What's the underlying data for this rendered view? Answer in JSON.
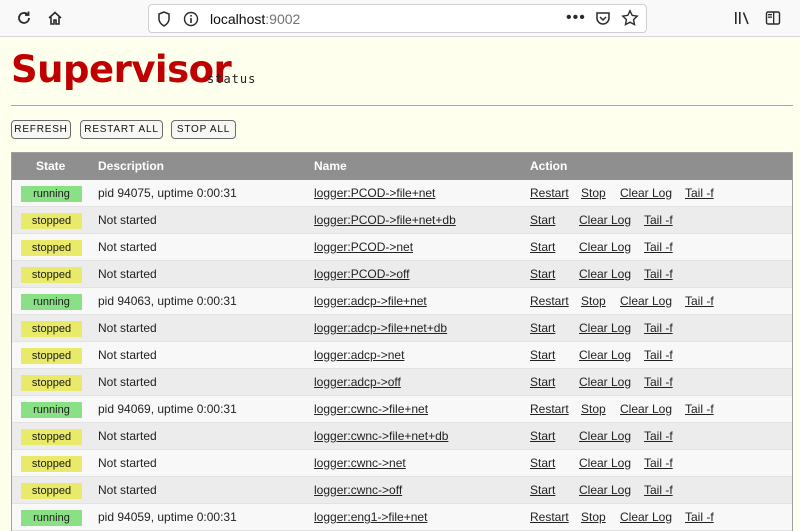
{
  "browser": {
    "url_host": "localhost",
    "url_port": ":9002"
  },
  "header": {
    "title": "Supervisor",
    "subtitle": "status"
  },
  "controls": {
    "refresh": "REFRESH",
    "restart_all": "RESTART ALL",
    "stop_all": "STOP ALL"
  },
  "table": {
    "headers": {
      "state": "State",
      "description": "Description",
      "name": "Name",
      "action": "Action"
    },
    "rows": [
      {
        "state": "running",
        "description": "pid 94075, uptime 0:00:31",
        "name": "logger:PCOD->file+net",
        "actions": [
          "Restart",
          "Stop",
          "Clear Log",
          "Tail -f"
        ]
      },
      {
        "state": "stopped",
        "description": "Not started",
        "name": "logger:PCOD->file+net+db",
        "actions": [
          "Start",
          "Clear Log",
          "Tail -f"
        ]
      },
      {
        "state": "stopped",
        "description": "Not started",
        "name": "logger:PCOD->net",
        "actions": [
          "Start",
          "Clear Log",
          "Tail -f"
        ]
      },
      {
        "state": "stopped",
        "description": "Not started",
        "name": "logger:PCOD->off",
        "actions": [
          "Start",
          "Clear Log",
          "Tail -f"
        ]
      },
      {
        "state": "running",
        "description": "pid 94063, uptime 0:00:31",
        "name": "logger:adcp->file+net",
        "actions": [
          "Restart",
          "Stop",
          "Clear Log",
          "Tail -f"
        ]
      },
      {
        "state": "stopped",
        "description": "Not started",
        "name": "logger:adcp->file+net+db",
        "actions": [
          "Start",
          "Clear Log",
          "Tail -f"
        ]
      },
      {
        "state": "stopped",
        "description": "Not started",
        "name": "logger:adcp->net",
        "actions": [
          "Start",
          "Clear Log",
          "Tail -f"
        ]
      },
      {
        "state": "stopped",
        "description": "Not started",
        "name": "logger:adcp->off",
        "actions": [
          "Start",
          "Clear Log",
          "Tail -f"
        ]
      },
      {
        "state": "running",
        "description": "pid 94069, uptime 0:00:31",
        "name": "logger:cwnc->file+net",
        "actions": [
          "Restart",
          "Stop",
          "Clear Log",
          "Tail -f"
        ]
      },
      {
        "state": "stopped",
        "description": "Not started",
        "name": "logger:cwnc->file+net+db",
        "actions": [
          "Start",
          "Clear Log",
          "Tail -f"
        ]
      },
      {
        "state": "stopped",
        "description": "Not started",
        "name": "logger:cwnc->net",
        "actions": [
          "Start",
          "Clear Log",
          "Tail -f"
        ]
      },
      {
        "state": "stopped",
        "description": "Not started",
        "name": "logger:cwnc->off",
        "actions": [
          "Start",
          "Clear Log",
          "Tail -f"
        ]
      },
      {
        "state": "running",
        "description": "pid 94059, uptime 0:00:31",
        "name": "logger:eng1->file+net",
        "actions": [
          "Restart",
          "Stop",
          "Clear Log",
          "Tail -f"
        ]
      }
    ]
  }
}
